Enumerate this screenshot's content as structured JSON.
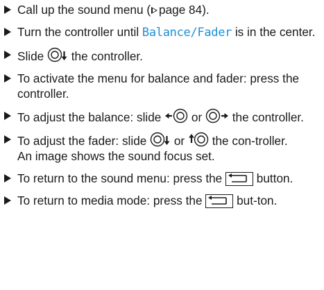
{
  "steps": [
    {
      "pre": "Call up the sound menu (",
      "page_ref": "page 84",
      "post": ")."
    },
    {
      "pre": "Turn the controller until ",
      "highlight": "Balance/Fader",
      "post": " is in the center."
    },
    {
      "pre": "Slide ",
      "post": " the controller."
    },
    {
      "text": "To activate the menu for balance and fader: press the controller."
    },
    {
      "pre": "To adjust the balance: slide ",
      "mid": " or ",
      "post": " the controller."
    },
    {
      "pre": "To adjust the fader: slide ",
      "mid": " or ",
      "post": " the con-troller.",
      "result": "An image shows the sound focus set."
    },
    {
      "pre": "To return to the sound menu: press the ",
      "post": " button."
    },
    {
      "pre": "To return to media mode: press the ",
      "post": " but-ton."
    }
  ],
  "icons": {
    "bullet": "triangle-bullet-icon",
    "controller": "controller-icon",
    "back_button": "back-button-icon",
    "page_ref": "page-ref-triangle-icon"
  },
  "colors": {
    "text": "#1a1a1a",
    "highlight": "#1f8fd6"
  }
}
